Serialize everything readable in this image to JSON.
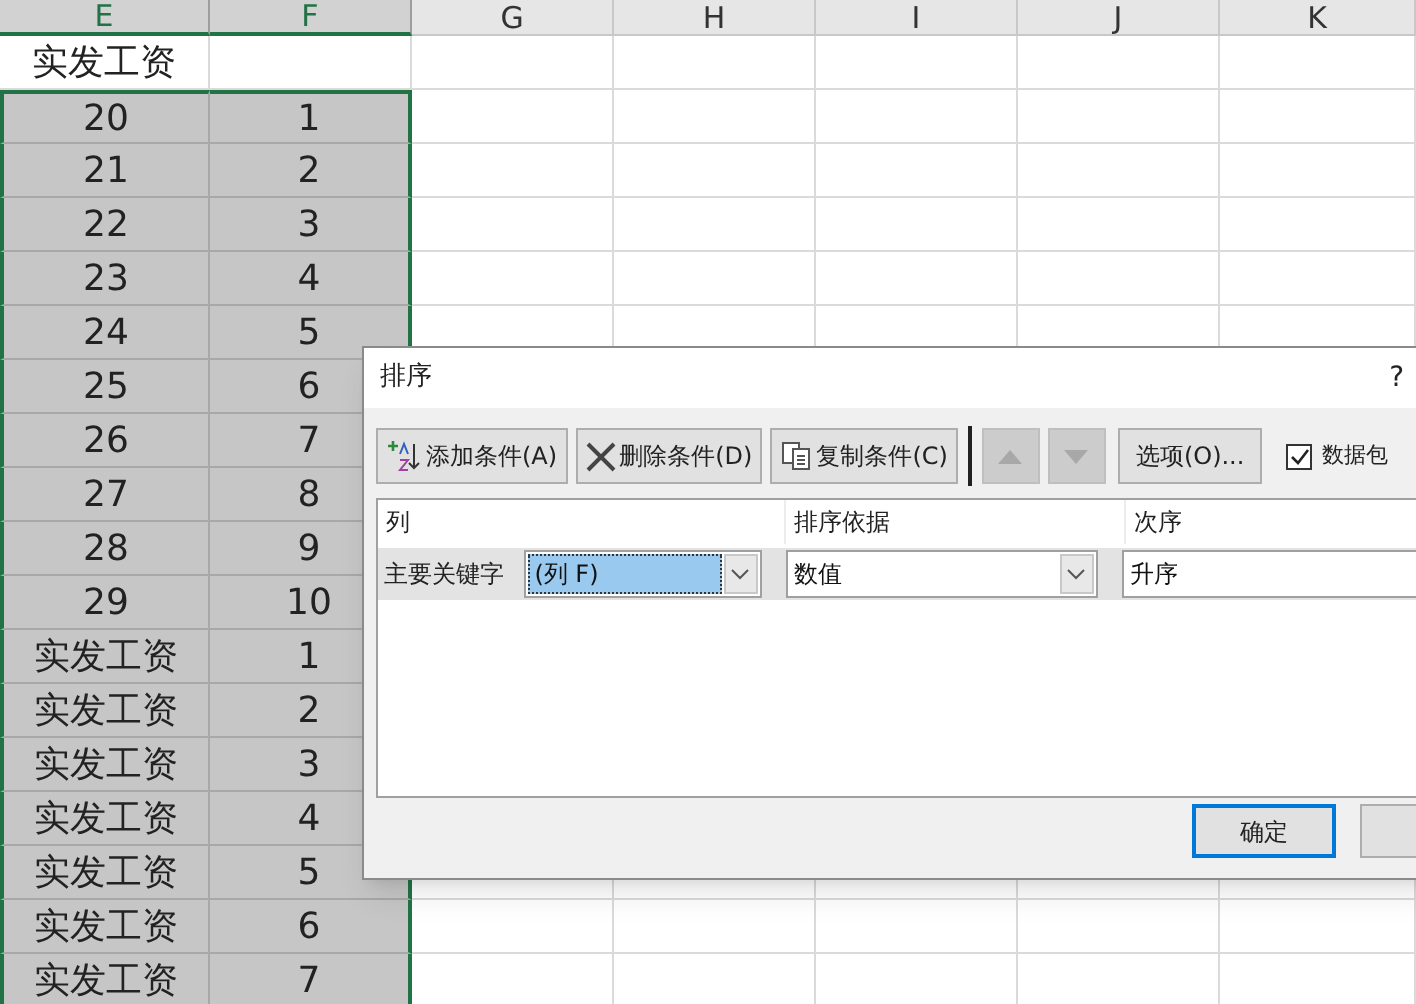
{
  "sheet": {
    "columns": [
      {
        "label": "E",
        "selected": true
      },
      {
        "label": "F",
        "selected": true
      },
      {
        "label": "G",
        "selected": false
      },
      {
        "label": "H",
        "selected": false
      },
      {
        "label": "I",
        "selected": false
      },
      {
        "label": "J",
        "selected": false
      },
      {
        "label": "K",
        "selected": false
      }
    ],
    "rows": [
      {
        "cells": [
          "实发工资"
        ],
        "selected": false
      },
      {
        "cells": [
          "20",
          "1"
        ],
        "selected": true
      },
      {
        "cells": [
          "21",
          "2"
        ],
        "selected": true
      },
      {
        "cells": [
          "22",
          "3"
        ],
        "selected": true
      },
      {
        "cells": [
          "23",
          "4"
        ],
        "selected": true
      },
      {
        "cells": [
          "24",
          "5"
        ],
        "selected": true
      },
      {
        "cells": [
          "25",
          "6"
        ],
        "selected": true
      },
      {
        "cells": [
          "26",
          "7"
        ],
        "selected": true
      },
      {
        "cells": [
          "27",
          "8"
        ],
        "selected": true
      },
      {
        "cells": [
          "28",
          "9"
        ],
        "selected": true
      },
      {
        "cells": [
          "29",
          "10"
        ],
        "selected": true
      },
      {
        "cells": [
          "实发工资",
          "1"
        ],
        "selected": true
      },
      {
        "cells": [
          "实发工资",
          "2"
        ],
        "selected": true
      },
      {
        "cells": [
          "实发工资",
          "3"
        ],
        "selected": true
      },
      {
        "cells": [
          "实发工资",
          "4"
        ],
        "selected": true
      },
      {
        "cells": [
          "实发工资",
          "5"
        ],
        "selected": true
      },
      {
        "cells": [
          "实发工资",
          "6"
        ],
        "selected": true
      },
      {
        "cells": [
          "实发工资",
          "7"
        ],
        "selected": true
      }
    ]
  },
  "dialog": {
    "title": "排序",
    "help": "?",
    "toolbar": [
      {
        "label": "添加条件(A)",
        "kind": "add"
      },
      {
        "label": "删除条件(D)",
        "kind": "delete"
      },
      {
        "label": "复制条件(C)",
        "kind": "copy"
      }
    ],
    "move_buttons": [
      {
        "kind": "up",
        "disabled": true
      },
      {
        "kind": "down",
        "disabled": true
      }
    ],
    "options_button": "选项(O)...",
    "header_checkbox": {
      "label": "数据包",
      "checked": true
    },
    "list_headers": [
      "列",
      "排序依据",
      "次序"
    ],
    "criteria": [
      {
        "label": "主要关键字",
        "column": "(列 F)",
        "sort_on": "数值",
        "order": "升序"
      }
    ],
    "ok_button": "确定"
  }
}
